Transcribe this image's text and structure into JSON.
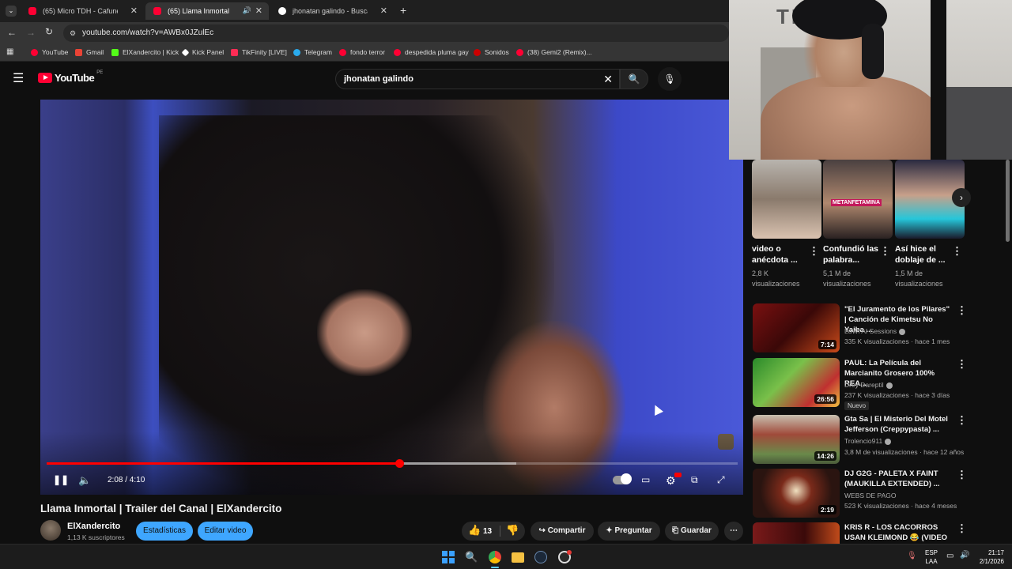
{
  "browser": {
    "tabs": [
      {
        "label": "(65) Micro TDH - Cafuné (Video",
        "active": false,
        "favicon_color": "#ff0033"
      },
      {
        "label": "(65) Llama Inmortal | Trailer",
        "active": true,
        "favicon_color": "#ff0033"
      },
      {
        "label": "jhonatan galindo - Buscar con G",
        "active": false,
        "favicon_color": "#ffffff"
      }
    ],
    "url": "youtube.com/watch?v=AWBx0JZulEc",
    "bookmarks": [
      {
        "label": "YouTube",
        "color": "#ff0033"
      },
      {
        "label": "Gmail",
        "color": "#ea4335"
      },
      {
        "label": "ElXandercito | Kick",
        "color": "#53fc18"
      },
      {
        "label": "Kick Panel",
        "color": "#ffffff"
      },
      {
        "label": "TikFinity [LIVE]",
        "color": "#fe2c55"
      },
      {
        "label": "Telegram",
        "color": "#2aabee"
      },
      {
        "label": "fondo terror",
        "color": "#ff0033"
      },
      {
        "label": "despedida pluma gay",
        "color": "#ff0033"
      },
      {
        "label": "Sonidos",
        "color": "#cc0000"
      },
      {
        "label": "(38) Gemi2 (Remix)...",
        "color": "#ff0033"
      }
    ]
  },
  "youtube": {
    "logo_text": "YouTube",
    "logo_region": "PE",
    "search_query": "jhonatan galindo"
  },
  "player": {
    "current_time": "2:08",
    "duration": "4:10",
    "time_display": "2:08 / 4:10",
    "progress_fraction": 0.51,
    "buffer_fraction": 0.68
  },
  "video": {
    "title": "Llama Inmortal | Trailer del Canal | ElXandercito",
    "channel_name": "ElXandercito",
    "channel_subs": "1,13 K suscriptores",
    "stats_button": "Estadísticas",
    "edit_button": "Editar video",
    "like_count": "13",
    "share_label": "Compartir",
    "ask_label": "Preguntar",
    "save_label": "Guardar"
  },
  "shorts": [
    {
      "title": "video o anécdota ...",
      "views": "2,8 K visualizaciones"
    },
    {
      "title": "Confundió las palabra...",
      "views": "5,1 M de visualizaciones",
      "overlay": "METANFETAMINA"
    },
    {
      "title": "Así hice el doblaje de ...",
      "views": "1,5 M de visualizaciones"
    }
  ],
  "recommendations": [
    {
      "title": "\"El Juramento de los Pilares\" | Canción de Kimetsu No Yaiba ...",
      "channel": "LuWi AI Sessions",
      "verified": true,
      "meta": "335 K visualizaciones · hace 1 mes",
      "duration": "7:14",
      "badge": ""
    },
    {
      "title": "PAUL: La Película del Marcianito Grosero 100% REA...",
      "channel": "Drey Dareptil",
      "verified": true,
      "meta": "237 K visualizaciones · hace 3 días",
      "duration": "26:56",
      "badge": "Nuevo"
    },
    {
      "title": "Gta Sa | El Misterio Del Motel Jefferson (Creppypasta) ...",
      "channel": "Trolencio911",
      "verified": true,
      "meta": "3,8 M de visualizaciones · hace 12 años",
      "duration": "14:26",
      "badge": ""
    },
    {
      "title": "DJ G2G - PALETA X FAINT (MAUKILLA EXTENDED) ...",
      "channel": "WEBS DE PAGO",
      "verified": false,
      "meta": "523 K visualizaciones · hace 4 meses",
      "duration": "2:19",
      "badge": ""
    },
    {
      "title": "KRIS R - LOS CACORROS USAN KLEIMOND 😂 (VIDEO OFICIAL)",
      "channel": "",
      "verified": false,
      "meta": "",
      "duration": "",
      "badge": ""
    }
  ],
  "taskbar": {
    "lang_line1": "ESP",
    "lang_line2": "LAA",
    "time": "21:17",
    "date": "2/1/2026"
  }
}
